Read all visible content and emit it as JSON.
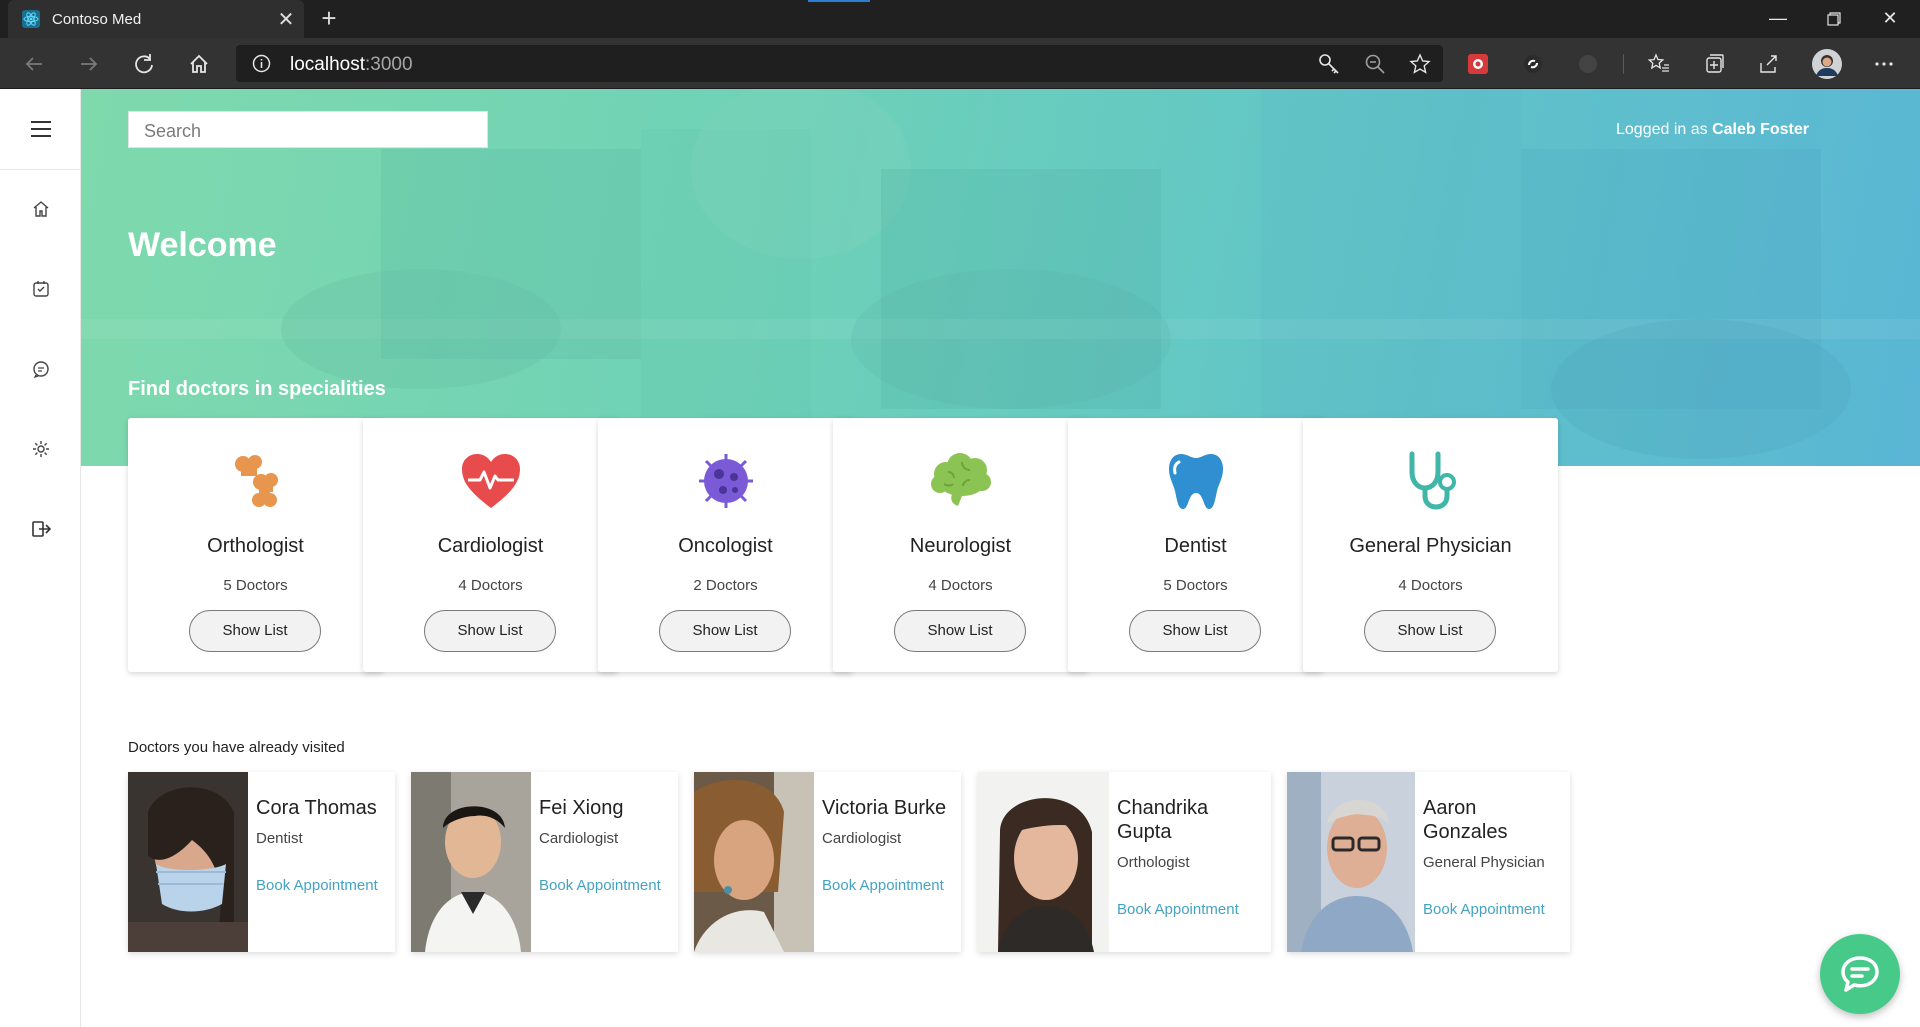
{
  "browser": {
    "tab_title": "Contoso Med",
    "url_host": "localhost",
    "url_port": ":3000"
  },
  "app": {
    "search_placeholder": "Search",
    "logged_in_prefix": "Logged in as ",
    "user_name": "Caleb Foster",
    "welcome": "Welcome",
    "specialities_heading": "Find doctors in specialities",
    "visited_heading": "Doctors you have already visited"
  },
  "specialities": [
    {
      "name": "Orthologist",
      "count": "5 Doctors",
      "button": "Show List",
      "icon": "bones-icon",
      "color": "#e8954e"
    },
    {
      "name": "Cardiologist",
      "count": "4 Doctors",
      "button": "Show List",
      "icon": "heart-pulse-icon",
      "color": "#e84b4b"
    },
    {
      "name": "Oncologist",
      "count": "2 Doctors",
      "button": "Show List",
      "icon": "cell-icon",
      "color": "#7a5ad6"
    },
    {
      "name": "Neurologist",
      "count": "4 Doctors",
      "button": "Show List",
      "icon": "brain-icon",
      "color": "#8cc454"
    },
    {
      "name": "Dentist",
      "count": "5 Doctors",
      "button": "Show List",
      "icon": "tooth-icon",
      "color": "#2f8fd0"
    },
    {
      "name": "General Physician",
      "count": "4 Doctors",
      "button": "Show List",
      "icon": "stethoscope-icon",
      "color": "#3fb6a8"
    }
  ],
  "visited_doctors": [
    {
      "name": "Cora Thomas",
      "specialty": "Dentist",
      "action": "Book Appointment"
    },
    {
      "name": "Fei Xiong",
      "specialty": "Cardiologist",
      "action": "Book Appointment"
    },
    {
      "name": "Victoria Burke",
      "specialty": "Cardiologist",
      "action": "Book Appointment"
    },
    {
      "name": "Chandrika Gupta",
      "specialty": "Orthologist",
      "action": "Book Appointment"
    },
    {
      "name": "Aaron Gonzales",
      "specialty": "General Physician",
      "action": "Book Appointment"
    }
  ],
  "sidebar_icons": [
    "menu-icon",
    "home-icon",
    "calendar-check-icon",
    "chat-icon",
    "settings-icon",
    "logout-icon"
  ]
}
